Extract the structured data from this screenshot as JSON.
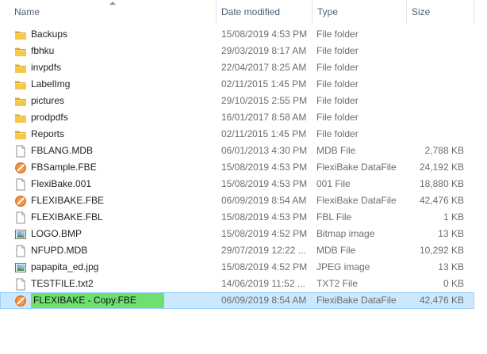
{
  "columns": {
    "name": "Name",
    "date": "Date modified",
    "type": "Type",
    "size": "Size"
  },
  "files": [
    {
      "name": "Backups",
      "date": "15/08/2019 4:53 PM",
      "type": "File folder",
      "size": "",
      "icon": "folder-icon"
    },
    {
      "name": "fbhku",
      "date": "29/03/2019 8:17 AM",
      "type": "File folder",
      "size": "",
      "icon": "folder-icon"
    },
    {
      "name": "invpdfs",
      "date": "22/04/2017 8:25 AM",
      "type": "File folder",
      "size": "",
      "icon": "folder-icon"
    },
    {
      "name": "LabelImg",
      "date": "02/11/2015 1:45 PM",
      "type": "File folder",
      "size": "",
      "icon": "folder-icon"
    },
    {
      "name": "pictures",
      "date": "29/10/2015 2:55 PM",
      "type": "File folder",
      "size": "",
      "icon": "folder-icon"
    },
    {
      "name": "prodpdfs",
      "date": "16/01/2017 8:58 AM",
      "type": "File folder",
      "size": "",
      "icon": "folder-icon"
    },
    {
      "name": "Reports",
      "date": "02/11/2015 1:45 PM",
      "type": "File folder",
      "size": "",
      "icon": "folder-icon"
    },
    {
      "name": "FBLANG.MDB",
      "date": "06/01/2013 4:30 PM",
      "type": "MDB File",
      "size": "2,788 KB",
      "icon": "blank-file-icon"
    },
    {
      "name": "FBSample.FBE",
      "date": "15/08/2019 4:53 PM",
      "type": "FlexiBake DataFile",
      "size": "24,192 KB",
      "icon": "flexibake-file-icon"
    },
    {
      "name": "FlexiBake.001",
      "date": "15/08/2019 4:53 PM",
      "type": "001 File",
      "size": "18,880 KB",
      "icon": "blank-file-icon"
    },
    {
      "name": "FLEXIBAKE.FBE",
      "date": "06/09/2019 8:54 AM",
      "type": "FlexiBake DataFile",
      "size": "42,476 KB",
      "icon": "flexibake-file-icon"
    },
    {
      "name": "FLEXIBAKE.FBL",
      "date": "15/08/2019 4:53 PM",
      "type": "FBL File",
      "size": "1 KB",
      "icon": "blank-file-icon"
    },
    {
      "name": "LOGO.BMP",
      "date": "15/08/2019 4:52 PM",
      "type": "Bitmap image",
      "size": "13 KB",
      "icon": "image-file-icon"
    },
    {
      "name": "NFUPD.MDB",
      "date": "29/07/2019 12:22 ...",
      "type": "MDB File",
      "size": "10,292 KB",
      "icon": "blank-file-icon"
    },
    {
      "name": "papapita_ed.jpg",
      "date": "15/08/2019 4:52 PM",
      "type": "JPEG image",
      "size": "13 KB",
      "icon": "image-file-icon"
    },
    {
      "name": "TESTFILE.txt2",
      "date": "14/06/2019 11:52 ...",
      "type": "TXT2 File",
      "size": "0 KB",
      "icon": "blank-file-icon"
    },
    {
      "name": "FLEXIBAKE - Copy.FBE",
      "date": "06/09/2019 8:54 AM",
      "type": "FlexiBake DataFile",
      "size": "42,476 KB",
      "icon": "flexibake-file-icon",
      "selected": true,
      "renaming": true
    }
  ],
  "colors": {
    "header_text": "#4c607a",
    "detail_text": "#6d6d6d",
    "selection_bg": "#cce8ff",
    "selection_border": "#99d1ff",
    "rename_highlight": "#6fe06f",
    "folder": "#e8b73a",
    "flexibake_icon": "#e8742a"
  }
}
